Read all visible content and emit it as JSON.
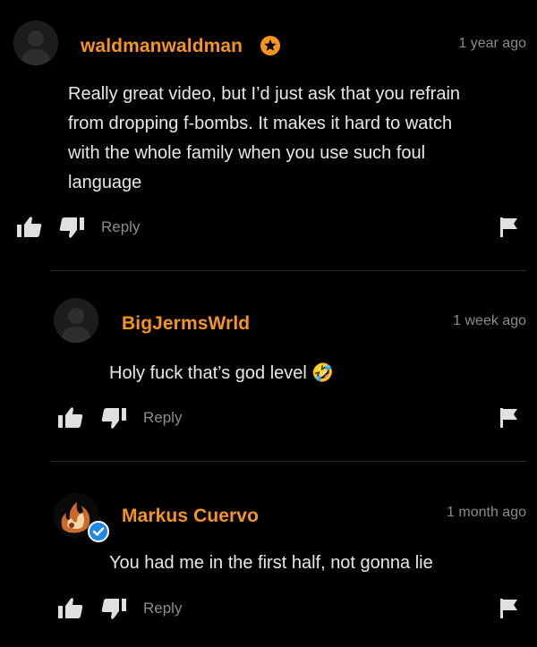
{
  "colors": {
    "background": "#000000",
    "username": "#f7941d",
    "muted": "#8c8c8c",
    "text": "#e8e8e8",
    "verified": "#1e88e5"
  },
  "comments": [
    {
      "username": "waldmanwaldman",
      "badge_icon": "star-badge-icon",
      "timestamp": "1 year ago",
      "lines": [
        "Really great video, but I’d just ask that you refrain",
        "from dropping f-bombs. It makes it hard to watch",
        "with the whole family when you use such foul",
        "language"
      ],
      "reply_label": "Reply"
    },
    {
      "username": "BigJermsWrld",
      "timestamp": "1 week ago",
      "text": "Holy fuck that’s god level",
      "emoji": "🤣",
      "reply_label": "Reply"
    },
    {
      "username": "Markus Cuervo",
      "badge_icon": "verified-check-icon",
      "timestamp": "1 month ago",
      "text": "You had me in the first half, not gonna lie",
      "reply_label": "Reply"
    }
  ]
}
